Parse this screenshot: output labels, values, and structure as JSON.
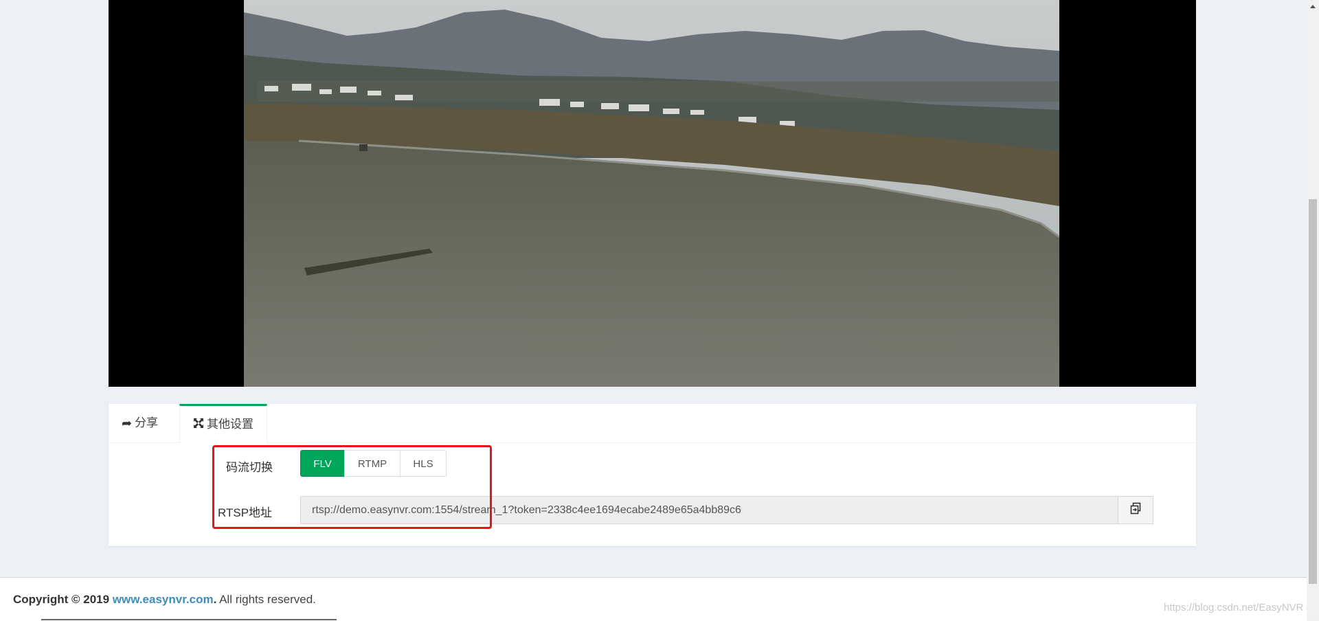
{
  "video": {
    "description_icon": "video-stream"
  },
  "tabs": {
    "share_label": "分享",
    "share_icon": "share-arrow-icon",
    "other_label": "其他设置",
    "other_icon": "expand-arrows-icon"
  },
  "stream": {
    "label": "码流切换",
    "options": [
      "FLV",
      "RTMP",
      "HLS"
    ],
    "selected": "FLV"
  },
  "rtsp": {
    "label": "RTSP地址",
    "value": "rtsp://demo.easynvr.com:1554/stream_1?token=2338c4ee1694ecabe2489e65a4bb89c6",
    "copy_icon": "copy-icon"
  },
  "footer": {
    "copyright_prefix": "Copyright © 2019",
    "link_text": "www.easynvr.com",
    "suffix": ". All rights reserved.",
    "watermark": "https://blog.csdn.net/EasyNVR"
  },
  "colors": {
    "accent": "#00a65a",
    "highlight": "#e8141a",
    "link": "#3c8dbc"
  }
}
